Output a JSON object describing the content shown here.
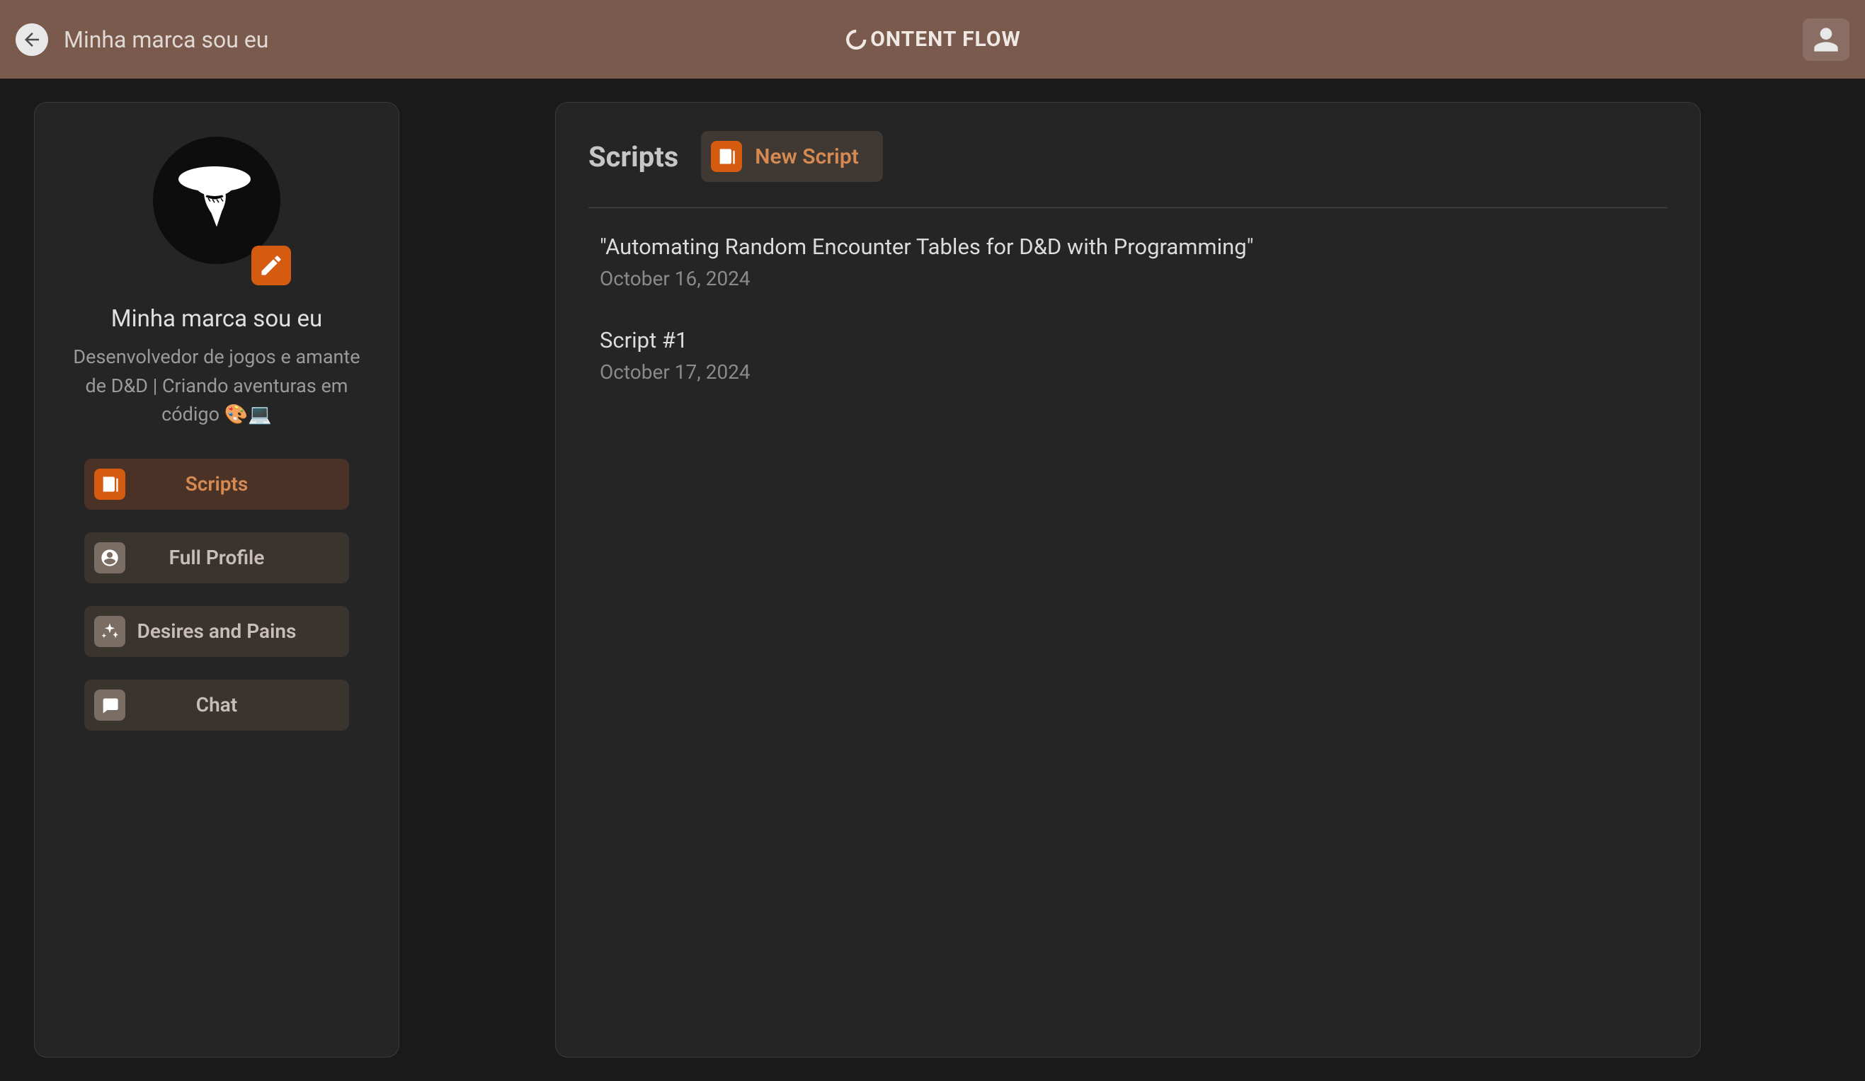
{
  "header": {
    "breadcrumb": "Minha marca sou eu",
    "brand": "ONTENT FLOW"
  },
  "profile": {
    "name": "Minha marca sou eu",
    "bio": "Desenvolvedor de jogos e amante de D&D | Criando aventuras em código 🎨💻"
  },
  "sidebar": {
    "items": [
      {
        "label": "Scripts",
        "icon": "scripts"
      },
      {
        "label": "Full Profile",
        "icon": "profile"
      },
      {
        "label": "Desires and Pains",
        "icon": "sparkle"
      },
      {
        "label": "Chat",
        "icon": "chat"
      }
    ]
  },
  "main": {
    "title": "Scripts",
    "new_button": "New Script",
    "scripts": [
      {
        "title": "\"Automating Random Encounter Tables for D&D with Programming\"",
        "date": "October 16, 2024"
      },
      {
        "title": "Script #1",
        "date": "October 17, 2024"
      }
    ]
  }
}
